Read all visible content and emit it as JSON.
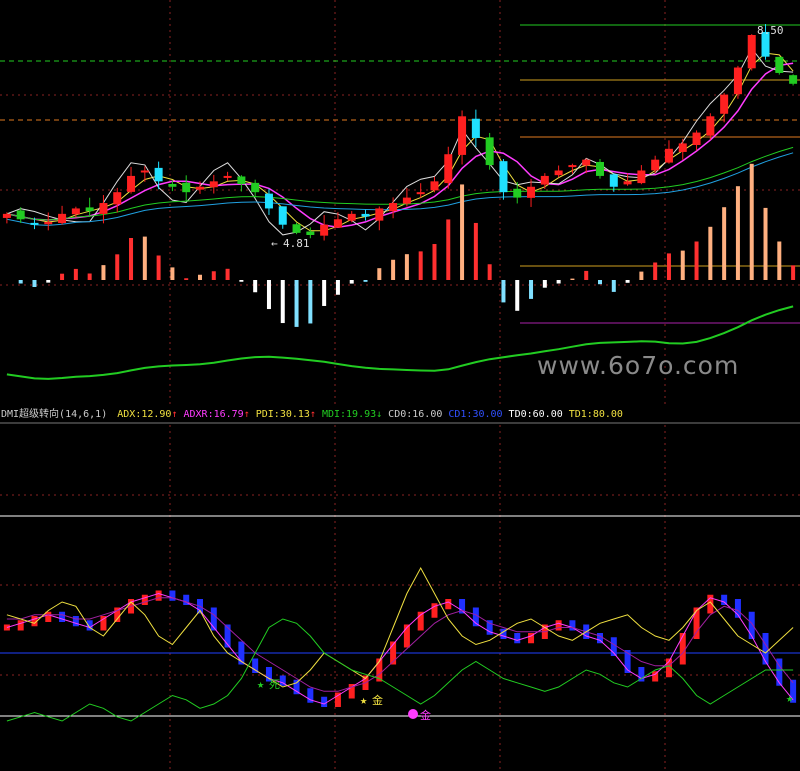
{
  "watermark": "www.6o7o.com",
  "top_panel": {
    "price_label_high": "8.50",
    "price_label_low": "4.81",
    "colors": {
      "up": "#ff2020",
      "down": "#20e0ff",
      "green_line": "#22cc22",
      "ma_pink": "#ff3cff",
      "ma_yellow": "#f0e040",
      "ma_white": "#dddddd",
      "grid_red": "#8a2222",
      "dash_green": "#22cc22",
      "dash_orange": "#e07a20"
    }
  },
  "indicator_header": {
    "name": "DMI超级转向(14,6,1)",
    "items": [
      {
        "text": "ADX:12.90",
        "arrow": "↑",
        "color": "#f0e040"
      },
      {
        "text": "ADXR:16.79",
        "arrow": "↑",
        "color": "#ff3cff"
      },
      {
        "text": "PDI:30.13",
        "arrow": "↑",
        "color": "#f0e040"
      },
      {
        "text": "MDI:19.93",
        "arrow": "↓",
        "color": "#22cc22"
      },
      {
        "text": "CD0:16.00",
        "arrow": "",
        "color": "#cccccc"
      },
      {
        "text": "CD1:30.00",
        "arrow": "",
        "color": "#3050ff"
      },
      {
        "text": "TD0:60.00",
        "arrow": "",
        "color": "#ffffff"
      },
      {
        "text": "TD1:80.00",
        "arrow": "",
        "color": "#f0e040"
      }
    ]
  },
  "bottom_panel": {
    "signal_dead": "死",
    "signal_gold_1": "金",
    "signal_gold_2": "金"
  },
  "chart_data": [
    {
      "type": "candlestick",
      "title": "",
      "price_labels": [
        "8.50",
        "4.81"
      ],
      "close_trend": [
        5.2,
        5.1,
        5.0,
        5.05,
        5.2,
        5.3,
        5.25,
        5.4,
        5.6,
        5.9,
        6.0,
        5.8,
        5.7,
        5.6,
        5.7,
        5.8,
        5.9,
        5.75,
        5.6,
        5.3,
        5.0,
        4.85,
        4.81,
        5.0,
        5.1,
        5.2,
        5.15,
        5.3,
        5.4,
        5.5,
        5.6,
        5.8,
        6.3,
        7.0,
        6.6,
        6.1,
        5.6,
        5.5,
        5.7,
        5.9,
        6.0,
        6.1,
        6.2,
        5.9,
        5.7,
        5.8,
        6.0,
        6.2,
        6.4,
        6.5,
        6.7,
        7.0,
        7.4,
        7.9,
        8.5,
        8.1,
        7.8,
        7.6
      ]
    },
    {
      "type": "line",
      "title": "DMI超级转向(14,6,1)",
      "series": [
        {
          "name": "ADX",
          "values": [
            30,
            31,
            32,
            33,
            32,
            31,
            30,
            32,
            34,
            36,
            37,
            38,
            37,
            36,
            34,
            30,
            26,
            22,
            20,
            18,
            17,
            15,
            13,
            12,
            14,
            16,
            18,
            22,
            26,
            30,
            33,
            35,
            36,
            34,
            31,
            29,
            28,
            27,
            28,
            30,
            31,
            30,
            28,
            27,
            24,
            20,
            18,
            19,
            22,
            28,
            34,
            37,
            36,
            33,
            28,
            22,
            17,
            13
          ]
        },
        {
          "name": "ADXR",
          "values": [
            32,
            32,
            33,
            33,
            33,
            32,
            32,
            33,
            34,
            35,
            36,
            37,
            37,
            36,
            35,
            33,
            30,
            27,
            24,
            22,
            20,
            18,
            16,
            15,
            15,
            16,
            17,
            19,
            22,
            25,
            28,
            31,
            33,
            34,
            33,
            31,
            30,
            29,
            29,
            29,
            30,
            30,
            29,
            28,
            26,
            24,
            22,
            21,
            21,
            24,
            29,
            33,
            35,
            34,
            31,
            26,
            21,
            17
          ]
        },
        {
          "name": "PDI",
          "values": [
            33,
            32,
            31,
            34,
            36,
            35,
            30,
            28,
            32,
            36,
            33,
            28,
            26,
            30,
            34,
            28,
            24,
            22,
            20,
            18,
            16,
            17,
            20,
            24,
            22,
            20,
            18,
            22,
            30,
            38,
            44,
            38,
            32,
            28,
            26,
            27,
            29,
            31,
            32,
            30,
            28,
            27,
            29,
            31,
            32,
            33,
            30,
            28,
            27,
            30,
            34,
            36,
            32,
            28,
            26,
            24,
            27,
            30
          ]
        },
        {
          "name": "MDI",
          "values": [
            8,
            9,
            10,
            9,
            8,
            10,
            12,
            11,
            9,
            8,
            10,
            12,
            14,
            13,
            11,
            12,
            14,
            18,
            24,
            30,
            32,
            31,
            28,
            24,
            22,
            20,
            19,
            18,
            16,
            14,
            12,
            14,
            17,
            20,
            22,
            20,
            18,
            17,
            16,
            15,
            16,
            18,
            20,
            19,
            17,
            16,
            18,
            20,
            21,
            18,
            14,
            12,
            14,
            16,
            18,
            20,
            20,
            20
          ]
        }
      ],
      "reference_levels": {
        "CD0": 16.0,
        "CD1": 30.0,
        "TD0": 60.0,
        "TD1": 80.0
      }
    }
  ]
}
